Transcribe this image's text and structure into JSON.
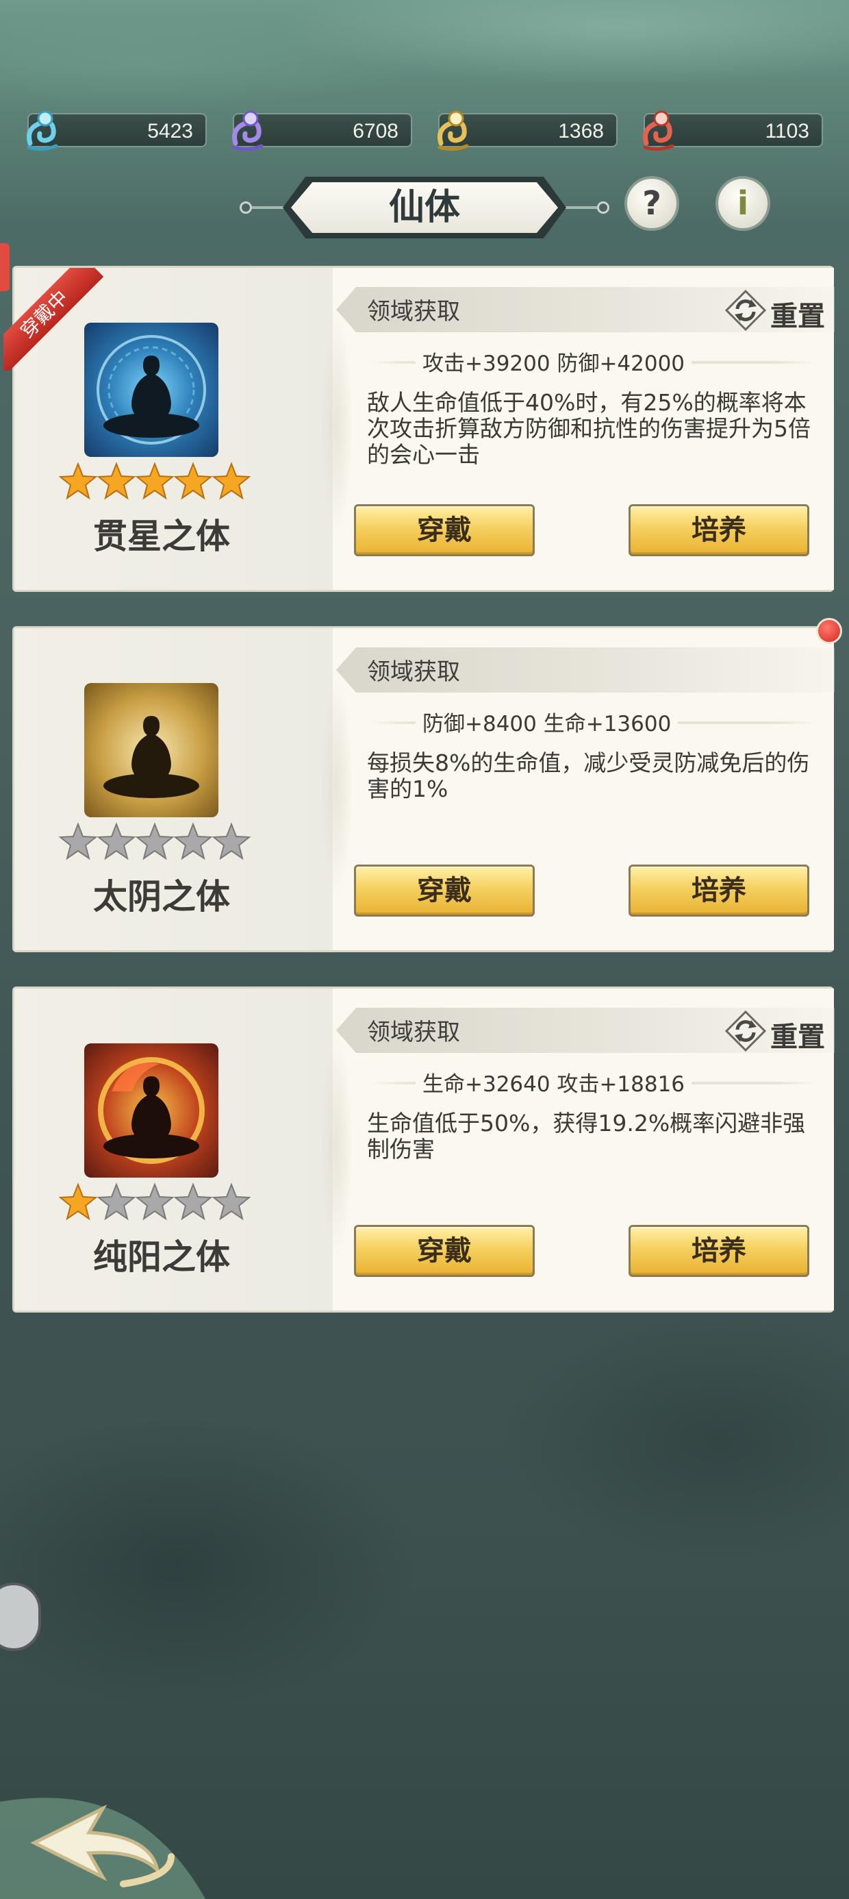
{
  "currencies": [
    {
      "icon": "cyan-spirit-icon",
      "value": "5423",
      "color": "#6fd0ea"
    },
    {
      "icon": "purple-spirit-icon",
      "value": "6708",
      "color": "#a28ae6"
    },
    {
      "icon": "gold-spirit-icon",
      "value": "1368",
      "color": "#e6c15a"
    },
    {
      "icon": "red-spirit-icon",
      "value": "1103",
      "color": "#e2634f"
    }
  ],
  "header": {
    "title": "仙体",
    "help_icon": "?",
    "info_icon": "i"
  },
  "cards": [
    {
      "wearing_tag": "穿戴中",
      "emblem": "blue-meditation-emblem",
      "stars": 5,
      "name": "贯星之体",
      "domain": "领域获取",
      "reset_label": "重置",
      "stats": "攻击+39200 防御+42000",
      "description": "敌人生命值低于40%时，有25%的概率将本次攻击折算敌方防御和抗性的伤害提升为5倍的会心一击",
      "wear_label": "穿戴",
      "train_label": "培养"
    },
    {
      "emblem": "gold-meditation-emblem",
      "stars": 0,
      "name": "太阴之体",
      "domain": "领域获取",
      "stats": "防御+8400 生命+13600",
      "description": "每损失8%的生命值，减少受灵防减免后的伤害的1%",
      "wear_label": "穿戴",
      "train_label": "培养"
    },
    {
      "emblem": "red-meditation-emblem",
      "stars": 1,
      "name": "纯阳之体",
      "domain": "领域获取",
      "reset_label": "重置",
      "stats": "生命+32640 攻击+18816",
      "description": "生命值低于50%，获得19.2%概率闪避非强制伤害",
      "wear_label": "穿戴",
      "train_label": "培养"
    }
  ],
  "colors": {
    "button_gold": "#f5d060",
    "card_bg": "#f3f1e8",
    "star_on": "#f5a623",
    "star_off": "#a9a9a9",
    "ribbon_red": "#d23a2e"
  }
}
